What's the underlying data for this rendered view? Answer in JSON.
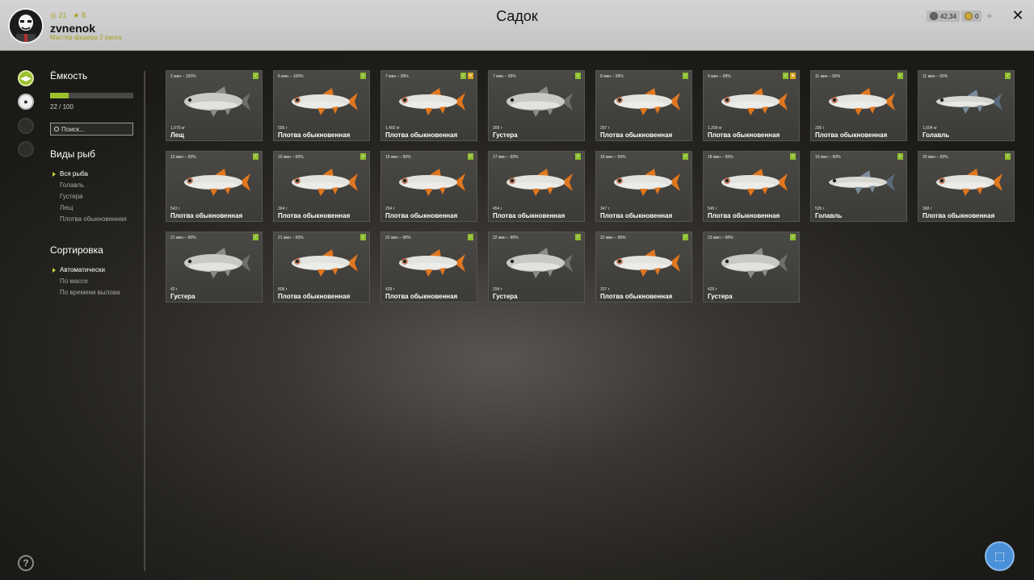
{
  "header": {
    "stat_level": "21",
    "stat_rank": "8",
    "username": "zvnenok",
    "user_title": "Мастер фидера 2 ранга",
    "title": "Садок",
    "silver": "42,34",
    "gold": "0",
    "add_label": "+",
    "close_label": "✕"
  },
  "sidebar": {
    "capacity_heading": "Ёмкость",
    "capacity_value": 0.22,
    "capacity_text": "22 / 100",
    "search_placeholder": "Поиск...",
    "species_heading": "Виды рыб",
    "species": [
      {
        "label": "Вся рыба",
        "active": true
      },
      {
        "label": "Голавль",
        "active": false
      },
      {
        "label": "Густера",
        "active": false
      },
      {
        "label": "Лещ",
        "active": false
      },
      {
        "label": "Плотва обыкновенная",
        "active": false
      }
    ],
    "sort_heading": "Сортировка",
    "sort": [
      {
        "label": "Автоматически",
        "active": true
      },
      {
        "label": "По массе",
        "active": false
      },
      {
        "label": "По времени вылова",
        "active": false
      }
    ],
    "help_label": "?"
  },
  "fish": [
    {
      "time": "2 мин – 100%",
      "weight": "1,076 кг",
      "name": "Лещ",
      "kind": "bream",
      "badges": [
        "green"
      ]
    },
    {
      "time": "6 мин – 100%",
      "weight": "595 г",
      "name": "Плотва обыкновенная",
      "kind": "roach",
      "badges": [
        "green"
      ]
    },
    {
      "time": "7 мин – 99%",
      "weight": "1,492 кг",
      "name": "Плотва обыкновенная",
      "kind": "roach",
      "badges": [
        "green",
        "gold"
      ]
    },
    {
      "time": "7 мин – 99%",
      "weight": "309 г",
      "name": "Густера",
      "kind": "bream",
      "badges": [
        "green"
      ]
    },
    {
      "time": "8 мин – 99%",
      "weight": "267 г",
      "name": "Плотва обыкновенная",
      "kind": "roach",
      "badges": [
        "green"
      ]
    },
    {
      "time": "9 мин – 99%",
      "weight": "1,299 кг",
      "name": "Плотва обыкновенная",
      "kind": "roach",
      "badges": [
        "green",
        "gold"
      ]
    },
    {
      "time": "11 мин – 99%",
      "weight": "336 г",
      "name": "Плотва обыкновенная",
      "kind": "roach",
      "badges": [
        "green"
      ]
    },
    {
      "time": "11 мин – 99%",
      "weight": "1,694 кг",
      "name": "Голавль",
      "kind": "chub",
      "badges": [
        "green"
      ]
    },
    {
      "time": "13 мин – 99%",
      "weight": "543 г",
      "name": "Плотва обыкновенная",
      "kind": "roach",
      "badges": [
        "green"
      ]
    },
    {
      "time": "15 мин – 99%",
      "weight": "364 г",
      "name": "Плотва обыкновенная",
      "kind": "roach",
      "badges": [
        "green"
      ]
    },
    {
      "time": "16 мин – 99%",
      "weight": "254 г",
      "name": "Плотва обыкновенная",
      "kind": "roach",
      "badges": [
        "green"
      ]
    },
    {
      "time": "17 мин – 99%",
      "weight": "454 г",
      "name": "Плотва обыкновенная",
      "kind": "roach",
      "badges": [
        "green"
      ]
    },
    {
      "time": "18 мин – 99%",
      "weight": "347 г",
      "name": "Плотва обыкновенная",
      "kind": "roach",
      "badges": [
        "green"
      ]
    },
    {
      "time": "18 мин – 99%",
      "weight": "545 г",
      "name": "Плотва обыкновенная",
      "kind": "roach",
      "badges": [
        "green"
      ]
    },
    {
      "time": "19 мин – 99%",
      "weight": "535 г",
      "name": "Голавль",
      "kind": "chub",
      "badges": [
        "green"
      ]
    },
    {
      "time": "20 мин – 99%",
      "weight": "368 г",
      "name": "Плотва обыкновенная",
      "kind": "roach",
      "badges": [
        "green"
      ]
    },
    {
      "time": "21 мин – 99%",
      "weight": "42 г",
      "name": "Густера",
      "kind": "bream",
      "badges": [
        "green"
      ]
    },
    {
      "time": "21 мин – 99%",
      "weight": "808 г",
      "name": "Плотва обыкновенная",
      "kind": "roach",
      "badges": [
        "green"
      ]
    },
    {
      "time": "22 мин – 98%",
      "weight": "428 г",
      "name": "Плотва обыкновенная",
      "kind": "roach",
      "badges": [
        "green"
      ]
    },
    {
      "time": "22 мин – 98%",
      "weight": "294 г",
      "name": "Густера",
      "kind": "bream",
      "badges": [
        "green"
      ]
    },
    {
      "time": "22 мин – 98%",
      "weight": "337 г",
      "name": "Плотва обыкновенная",
      "kind": "roach",
      "badges": [
        "green"
      ]
    },
    {
      "time": "23 мин – 98%",
      "weight": "429 г",
      "name": "Густера",
      "kind": "bream",
      "badges": [
        "green"
      ]
    }
  ],
  "colors": {
    "accent_green": "#9bc02b",
    "badge_gold": "#d9a820",
    "cursor_blue": "#4a90d9"
  }
}
